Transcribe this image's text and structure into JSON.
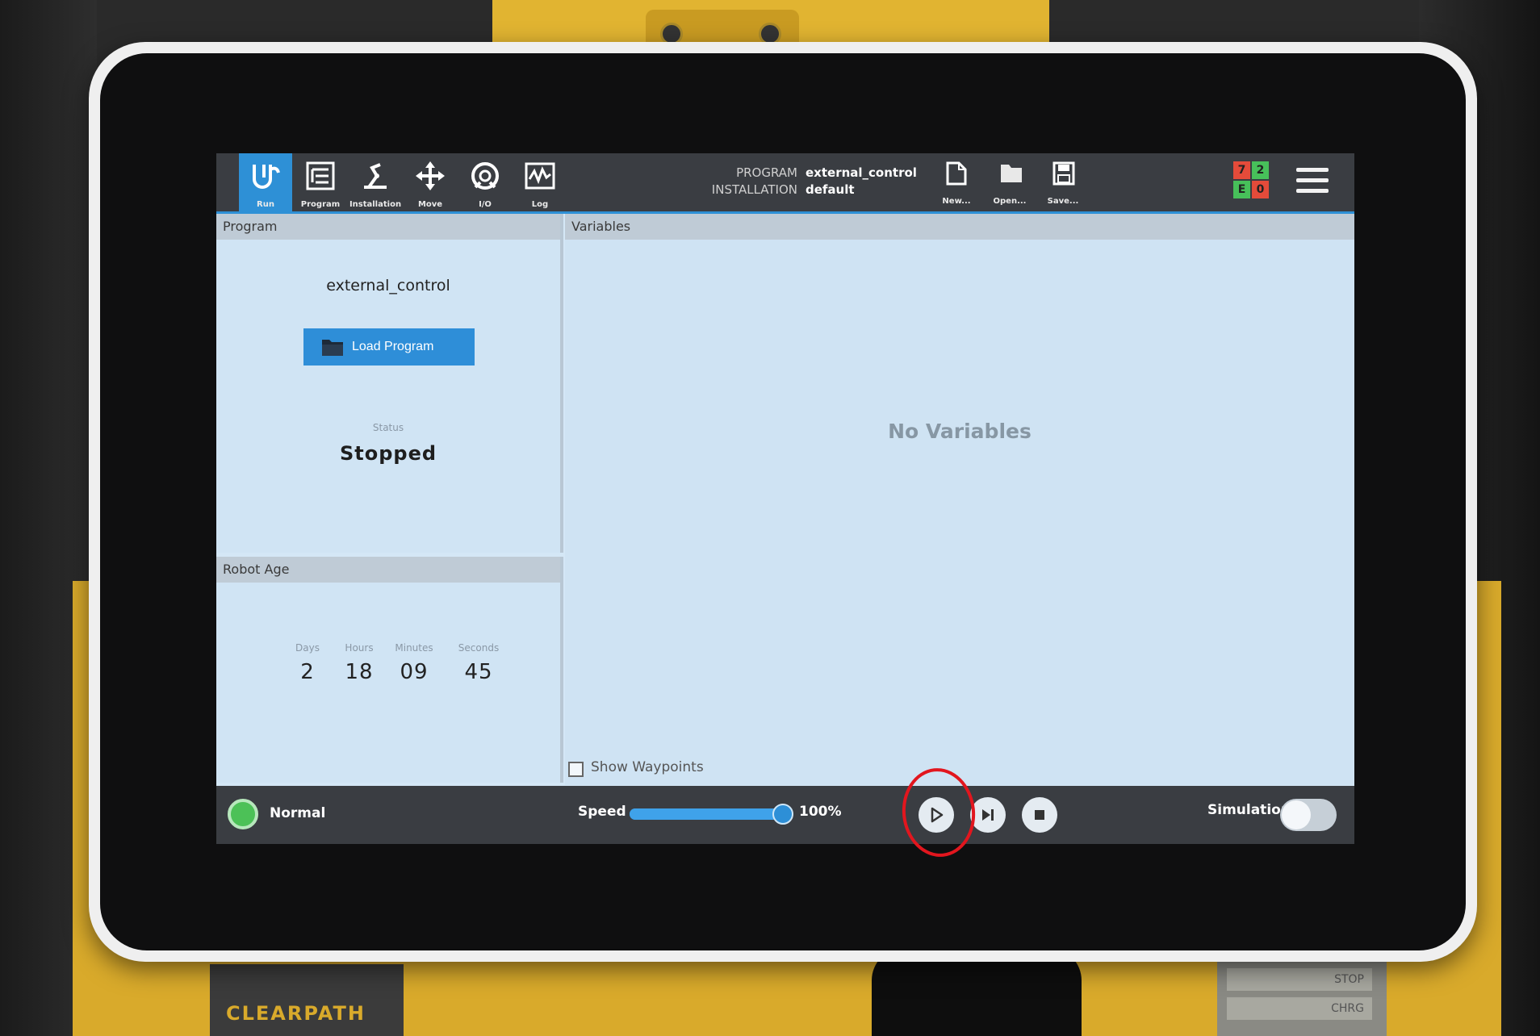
{
  "topbar": {
    "nav": [
      {
        "label": "Run",
        "icon": "ur-logo-icon"
      },
      {
        "label": "Program",
        "icon": "program-icon"
      },
      {
        "label": "Installation",
        "icon": "installation-icon"
      },
      {
        "label": "Move",
        "icon": "move-icon"
      },
      {
        "label": "I/O",
        "icon": "io-icon"
      },
      {
        "label": "Log",
        "icon": "log-icon"
      }
    ],
    "program_label": "PROGRAM",
    "program_value": "external_control",
    "installation_label": "INSTALLATION",
    "installation_value": "default",
    "file_buttons": [
      {
        "label": "New...",
        "icon": "new-file-icon"
      },
      {
        "label": "Open...",
        "icon": "open-folder-icon"
      },
      {
        "label": "Save...",
        "icon": "save-icon"
      }
    ],
    "status_grid": {
      "top_left": "7",
      "top_right": "2",
      "bottom_left": "E",
      "bottom_right": "0",
      "colors": {
        "red": "#e44b3a",
        "green": "#47c05a"
      }
    }
  },
  "program_panel": {
    "header": "Program",
    "program_name": "external_control",
    "load_button": "Load Program",
    "status_label": "Status",
    "status_value": "Stopped"
  },
  "robot_age": {
    "header": "Robot Age",
    "days_label": "Days",
    "days": "2",
    "hours_label": "Hours",
    "hours": "18",
    "minutes_label": "Minutes",
    "minutes": "09",
    "seconds_label": "Seconds",
    "seconds": "45"
  },
  "variables_panel": {
    "header": "Variables",
    "empty_text": "No Variables",
    "show_waypoints": "Show Waypoints",
    "show_waypoints_checked": false
  },
  "footer": {
    "mode": "Normal",
    "speed_label": "Speed",
    "speed_value": "100%",
    "speed_fraction": 1.0,
    "simulation_label": "Simulation",
    "simulation_on": false,
    "buttons": [
      "play-icon",
      "step-icon",
      "stop-icon"
    ]
  },
  "surroundings": {
    "brand_text": "CLEARPATH",
    "panel_stop": "STOP",
    "panel_chrg": "CHRG"
  },
  "colors": {
    "accent": "#2e90d6",
    "bar": "#3a3d42",
    "panel": "#d0e4f4",
    "annotation": "#e2161e"
  }
}
